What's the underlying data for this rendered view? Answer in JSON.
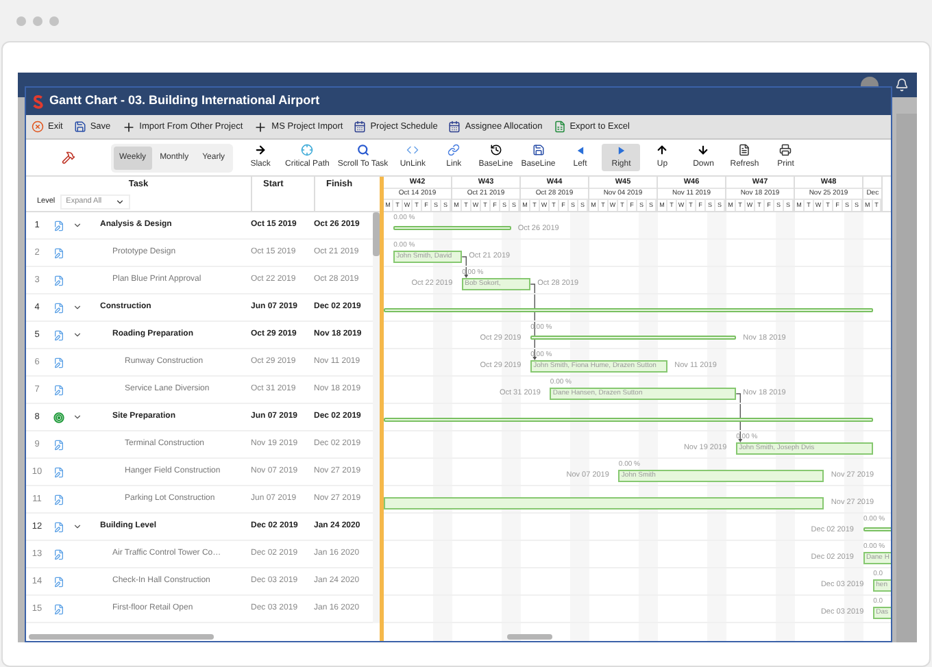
{
  "window": {
    "title": "Gantt Chart - 03. Building International Airport"
  },
  "menu": [
    {
      "label": "Exit",
      "kind": "exit"
    },
    {
      "label": "Save",
      "kind": "save"
    },
    {
      "label": "Import From Other Project",
      "kind": "plus"
    },
    {
      "label": "MS Project Import",
      "kind": "plus"
    },
    {
      "label": "Project Schedule",
      "kind": "calendar"
    },
    {
      "label": "Assignee Allocation",
      "kind": "calendar"
    },
    {
      "label": "Export to Excel",
      "kind": "excel"
    }
  ],
  "view_modes": [
    {
      "label": "Weekly",
      "selected": true
    },
    {
      "label": "Monthly",
      "selected": false
    },
    {
      "label": "Yearly",
      "selected": false
    }
  ],
  "tools": [
    {
      "label": "Slack",
      "kind": "arrow-right",
      "selected": false
    },
    {
      "label": "Critical Path",
      "kind": "target",
      "selected": false
    },
    {
      "label": "Scroll To Task",
      "kind": "search",
      "selected": false
    },
    {
      "label": "UnLink",
      "kind": "code",
      "selected": false
    },
    {
      "label": "Link",
      "kind": "link",
      "selected": false
    },
    {
      "label": "BaseLine",
      "kind": "history",
      "selected": false
    },
    {
      "label": "BaseLine",
      "kind": "save",
      "selected": false
    },
    {
      "label": "Left",
      "kind": "left",
      "selected": false
    },
    {
      "label": "Right",
      "kind": "right",
      "selected": true
    },
    {
      "label": "Up",
      "kind": "up",
      "selected": false
    },
    {
      "label": "Down",
      "kind": "down",
      "selected": false
    },
    {
      "label": "Refresh",
      "kind": "refresh",
      "selected": false
    },
    {
      "label": "Print",
      "kind": "print",
      "selected": false
    }
  ],
  "columns": {
    "task": "Task",
    "start": "Start",
    "finish": "Finish"
  },
  "level_filter": {
    "label": "Level",
    "value": "Expand All"
  },
  "weeks": [
    {
      "label": "W42",
      "date": "Oct 14 2019",
      "days": [
        "M",
        "T",
        "W",
        "T",
        "F",
        "S",
        "S"
      ]
    },
    {
      "label": "W43",
      "date": "Oct 21 2019",
      "days": [
        "M",
        "T",
        "W",
        "T",
        "F",
        "S",
        "S"
      ]
    },
    {
      "label": "W44",
      "date": "Oct 28 2019",
      "days": [
        "M",
        "T",
        "W",
        "T",
        "F",
        "S",
        "S"
      ]
    },
    {
      "label": "W45",
      "date": "Nov 04 2019",
      "days": [
        "M",
        "T",
        "W",
        "T",
        "F",
        "S",
        "S"
      ]
    },
    {
      "label": "W46",
      "date": "Nov 11 2019",
      "days": [
        "M",
        "T",
        "W",
        "T",
        "F",
        "S",
        "S"
      ]
    },
    {
      "label": "W47",
      "date": "Nov 18 2019",
      "days": [
        "M",
        "T",
        "W",
        "T",
        "F",
        "S",
        "S"
      ]
    },
    {
      "label": "W48",
      "date": "Nov 25 2019",
      "days": [
        "M",
        "T",
        "W",
        "T",
        "F",
        "S",
        "S"
      ]
    },
    {
      "date": "Dec",
      "days": [
        "M",
        "T"
      ]
    }
  ],
  "tasks": [
    {
      "id": "1",
      "name": "Analysis & Design",
      "start": "Oct 15 2019",
      "finish": "Oct 26 2019",
      "kind": "document",
      "expanded": true,
      "bar": {
        "percent": "0.00 %",
        "end_label": "Oct 26 2019"
      },
      "children": [
        {
          "id": "2",
          "name": "Prototype Design",
          "start": "Oct 15 2019",
          "finish": "Oct 21 2019",
          "kind": "document",
          "link_out": true,
          "link_in": false,
          "bar": {
            "percent": "0.00 %",
            "resources": "John Smith, David",
            "end_label": "Oct 21 2019"
          }
        },
        {
          "id": "3",
          "name": "Plan Blue Print Approval",
          "start": "Oct 22 2019",
          "finish": "Oct 28 2019",
          "kind": "document",
          "link_out": true,
          "link_in": true,
          "bar": {
            "start_label": "Oct 22 2019",
            "percent": "0.00 %",
            "resources": "Bob Sokort,",
            "end_label": "Oct 28 2019"
          }
        }
      ]
    },
    {
      "id": "4",
      "name": "Construction",
      "start": "Jun 07 2019",
      "finish": "Dec 02 2019",
      "kind": "document",
      "expanded": true,
      "children": [
        {
          "id": "5",
          "name": "Roading Preparation",
          "start": "Oct 29 2019",
          "finish": "Nov 18 2019",
          "kind": "document",
          "expanded": true,
          "bar": {
            "start_label": "Oct 29 2019",
            "percent": "0.00 %",
            "end_label": "Nov 18 2019"
          },
          "children": [
            {
              "id": "6",
              "name": "Runway Construction",
              "start": "Oct 29 2019",
              "finish": "Nov 11 2019",
              "kind": "document",
              "link_out": false,
              "link_in": true,
              "bar": {
                "start_label": "Oct 29 2019",
                "percent": "0.00 %",
                "resources": "John Smith, Fiona Hume, Drazen Sutton",
                "end_label": "Nov 11 2019"
              }
            },
            {
              "id": "7",
              "name": "Service Lane Diversion",
              "start": "Oct 31 2019",
              "finish": "Nov 18 2019",
              "kind": "document",
              "link_out": true,
              "link_in": false,
              "bar": {
                "start_label": "Oct 31 2019",
                "percent": "0.00 %",
                "resources": "Dane Hansen, Drazen Sutton",
                "end_label": "Nov 18 2019"
              }
            }
          ]
        },
        {
          "id": "8",
          "name": "Site Preparation",
          "start": "Jun 07 2019",
          "finish": "Dec 02 2019",
          "kind": "target",
          "expanded": true,
          "children": [
            {
              "id": "9",
              "name": "Terminal Construction",
              "start": "Nov 19 2019",
              "finish": "Dec 02 2019",
              "kind": "document",
              "link_out": false,
              "link_in": true,
              "bar": {
                "start_label": "Nov 19 2019",
                "percent": "0.00 %",
                "resources": "John Smith, Joseph Dvis"
              }
            },
            {
              "id": "10",
              "name": "Hanger Field Construction",
              "start": "Nov 07 2019",
              "finish": "Nov 27 2019",
              "kind": "document",
              "bar": {
                "start_label": "Nov 07 2019",
                "percent": "0.00 %",
                "resources": "John Smith",
                "end_label": "Nov 27 2019"
              }
            },
            {
              "id": "11",
              "name": "Parking Lot Construction",
              "start": "Jun 07 2019",
              "finish": "Nov 27 2019",
              "kind": "document",
              "bar": {
                "end_label": "Nov 27 2019"
              }
            }
          ]
        }
      ]
    },
    {
      "id": "12",
      "name": "Building Level",
      "start": "Dec 02 2019",
      "finish": "Jan 24 2020",
      "kind": "document",
      "expanded": true,
      "bar": {
        "start_label": "Dec 02 2019",
        "percent": "0.00 %"
      },
      "children": [
        {
          "id": "13",
          "name": "Air Traffic Control Tower Co…",
          "start": "Dec 02 2019",
          "finish": "Jan 16 2020",
          "kind": "document",
          "bar": {
            "start_label": "Dec 02 2019",
            "percent": "0.00 %",
            "resources": "Dane H"
          }
        },
        {
          "id": "14",
          "name": "Check-In Hall Construction",
          "start": "Dec 03 2019",
          "finish": "Jan 24 2020",
          "kind": "document",
          "bar": {
            "start_label": "Dec 03 2019",
            "percent": "0.0",
            "resources": "hen"
          }
        },
        {
          "id": "15",
          "name": "First-floor Retail Open",
          "start": "Dec 03 2019",
          "finish": "Jan 16 2020",
          "kind": "document",
          "bar": {
            "start_label": "Dec 03 2019",
            "percent": "0.0",
            "resources": "Das"
          }
        }
      ]
    }
  ]
}
